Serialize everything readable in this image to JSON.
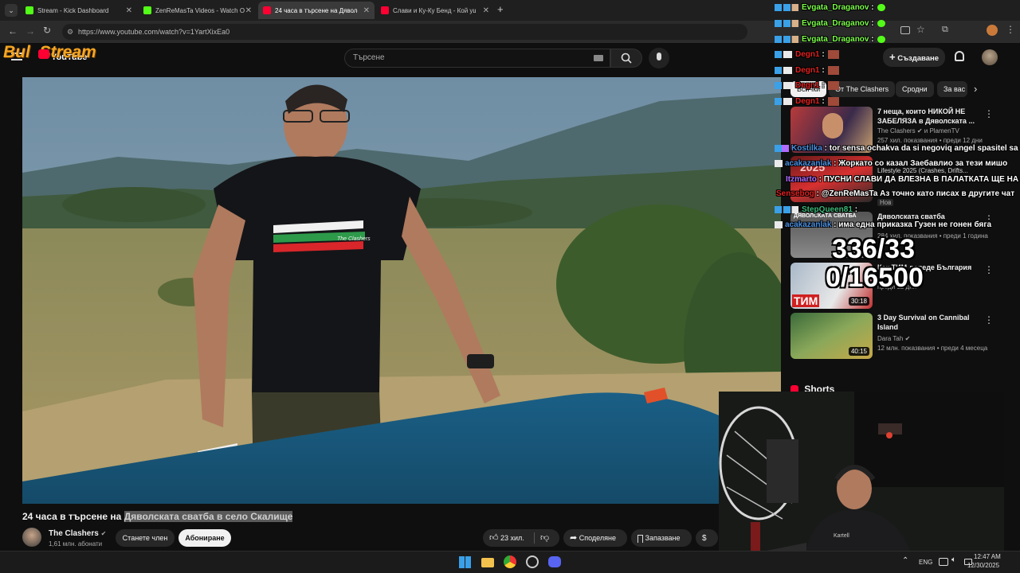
{
  "browser": {
    "tabs": [
      {
        "label": "Stream - Kick Dashboard",
        "icon": "kick-icon"
      },
      {
        "label": "ZenReMasTa Videos - Watch O",
        "icon": "kick-icon"
      },
      {
        "label": "24 часа в търсене на Дяволск",
        "icon": "youtube-icon"
      },
      {
        "label": "Слави и Ку-Ку Бенд - Кой уш",
        "icon": "youtube-icon"
      }
    ],
    "url": "https://www.youtube.com/watch?v=1YartXixEa0"
  },
  "youtube": {
    "search_placeholder": "Търсене",
    "create_label": "Създаване",
    "logo_text": "YouTube"
  },
  "overlay": {
    "brand_text": "Bul  Stream",
    "counter_top": "336/33",
    "counter_bottom": "0/16500",
    "chat": [
      {
        "user": "Evgata_Draganov",
        "sep": " :",
        "msg": "",
        "color": "#7CFC4C"
      },
      {
        "user": "Evgata_Draganov",
        "sep": " :",
        "msg": "",
        "color": "#7CFC4C"
      },
      {
        "user": "Evgata_Draganov",
        "sep": " :",
        "msg": "",
        "color": "#7CFC4C"
      },
      {
        "user": "Degn1",
        "sep": " :",
        "msg": "",
        "color": "#e02020"
      },
      {
        "user": "Degn1",
        "sep": " :",
        "msg": "",
        "color": "#e02020"
      },
      {
        "user": "Degn1",
        "sep": " :",
        "msg": "",
        "color": "#e02020"
      },
      {
        "user": "Degn1",
        "sep": " :",
        "msg": "",
        "color": "#e02020"
      },
      {
        "user": "Kostilka",
        "sep": " :",
        "msg": "tor sensa ochakva da si negoviq angel spasitel sa",
        "color": "#4a90e2"
      },
      {
        "user": "acakazanlak",
        "sep": " :",
        "msg": "Жоркато со казал Заебавлио за тези мишо",
        "color": "#4a90e2"
      },
      {
        "user": "Itzmarto",
        "sep": " :",
        "msg": "ПУСНИ СЛАВИ ДА ВЛЕЗНА В ПАЛАТКАТА ЩЕ НА",
        "color": "#b06bff"
      },
      {
        "user": "Sensebog",
        "sep": " :",
        "msg": "@ZenReMasTa Аз точно като писах в другите чат",
        "color": "#e02020"
      },
      {
        "user": "StepQueen81",
        "sep": " :",
        "msg": "",
        "color": "#3cb878"
      },
      {
        "user": "acakazanlak",
        "sep": " :",
        "msg": "има една приказка Гузен не гонен бяга",
        "color": "#4a90e2"
      }
    ]
  },
  "sidebar": {
    "chips": [
      "Всички",
      "От The Clashers",
      "Сродни",
      "За вас"
    ],
    "recs": [
      {
        "title": "7 неща, които НИКОЙ НЕ ЗАБЕЛЯЗА в Дяволската ...",
        "channel": "The Clashers",
        "channel2": "и PlamenTV",
        "meta": "257 хил. показвания • преди 12 дни",
        "duration": "",
        "thumb_text": ""
      },
      {
        "title": "",
        "channel": "Lifestyle 2025 (Crashes, Drifts...",
        "channel2": "",
        "meta": "",
        "duration": "",
        "thumb_text": "2025"
      },
      {
        "title": "Дяволската сватба",
        "channel": "",
        "channel2": "",
        "meta": "284 хил. показвания • преди 1 година",
        "duration": "",
        "thumb_text": "ДЯВОЛСКАТА СВАТБА"
      },
      {
        "title": "Как ТИМ доведе България",
        "channel": "",
        "channel2": "",
        "meta": "преди 12 дни",
        "duration": "30:18",
        "thumb_text": "ТИМ"
      },
      {
        "title": "3 Day Survival on Cannibal Island",
        "channel": "Dara Tah",
        "channel2": "",
        "meta": "12 млн. показвания • преди 4 месеца",
        "duration": "40:15",
        "thumb_text": ""
      }
    ],
    "new_badge": "Нов",
    "shorts_label": "Shorts"
  },
  "video": {
    "title_plain": "24 часа в търсене на ",
    "title_highlight": "Дяволската сватба в село Скалище",
    "channel": "The Clashers",
    "subs": "1,61 млн. абонати",
    "member_label": "Станете член",
    "subscribe_label": "Абониране",
    "likes": "23 хил.",
    "share_label": "Споделяне",
    "save_label": "Запазване",
    "shirt_text": "The Clashers",
    "webcam_shirt_text": "Kartell"
  },
  "taskbar": {
    "lang": "ENG",
    "time": "12:47 AM",
    "date": "12/30/2025"
  },
  "colors": {
    "accent_red": "#ff0033",
    "chat_green": "#7CFC4C",
    "kick_green": "#53fc18",
    "overlay_orange": "#f5a623"
  }
}
